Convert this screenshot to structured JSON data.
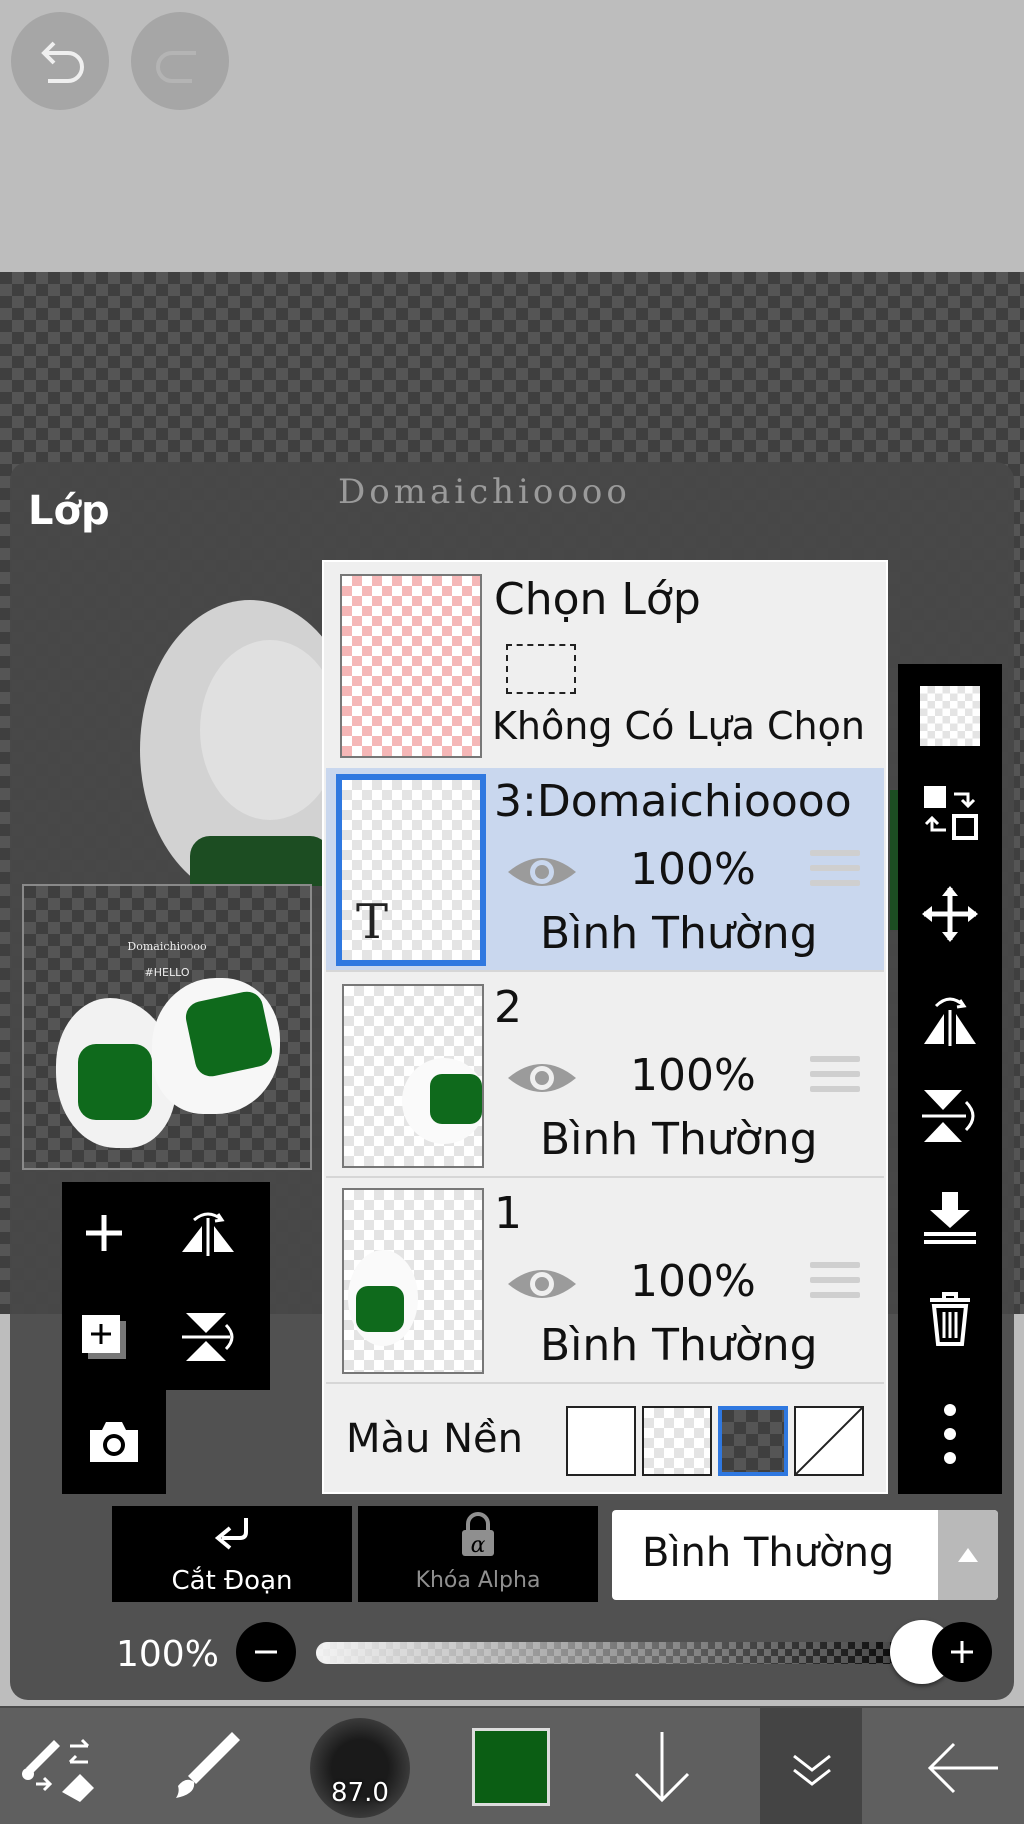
{
  "panel": {
    "title": "Lớp",
    "watermark": "Domaichioooo"
  },
  "preview": {
    "line1": "Domaichioooo",
    "line2": "#HELLO"
  },
  "selection_layer": {
    "title": "Chọn Lớp",
    "subtitle": "Không Có Lựa Chọn"
  },
  "layers": [
    {
      "name": "3:Domaichioooo",
      "opacity": "100%",
      "blend": "Bình Thường",
      "selected": true,
      "type_badge": "T"
    },
    {
      "name": "2",
      "opacity": "100%",
      "blend": "Bình Thường",
      "selected": false
    },
    {
      "name": "1",
      "opacity": "100%",
      "blend": "Bình Thường",
      "selected": false
    }
  ],
  "background_color": {
    "label": "Màu Nền",
    "selected_index": 2
  },
  "controls": {
    "clipping_label": "Cắt Đoạn",
    "alpha_lock_label": "Khóa Alpha",
    "blend_mode": "Bình Thường",
    "opacity_label": "100%",
    "opacity_value": 1.0
  },
  "bottom_bar": {
    "brush_size": "87.0",
    "current_color": "#0b5e14"
  },
  "colors": {
    "selected_row": "#c9d7ee",
    "selected_border": "#2f78e0",
    "leaf_green": "#0b5e14"
  }
}
